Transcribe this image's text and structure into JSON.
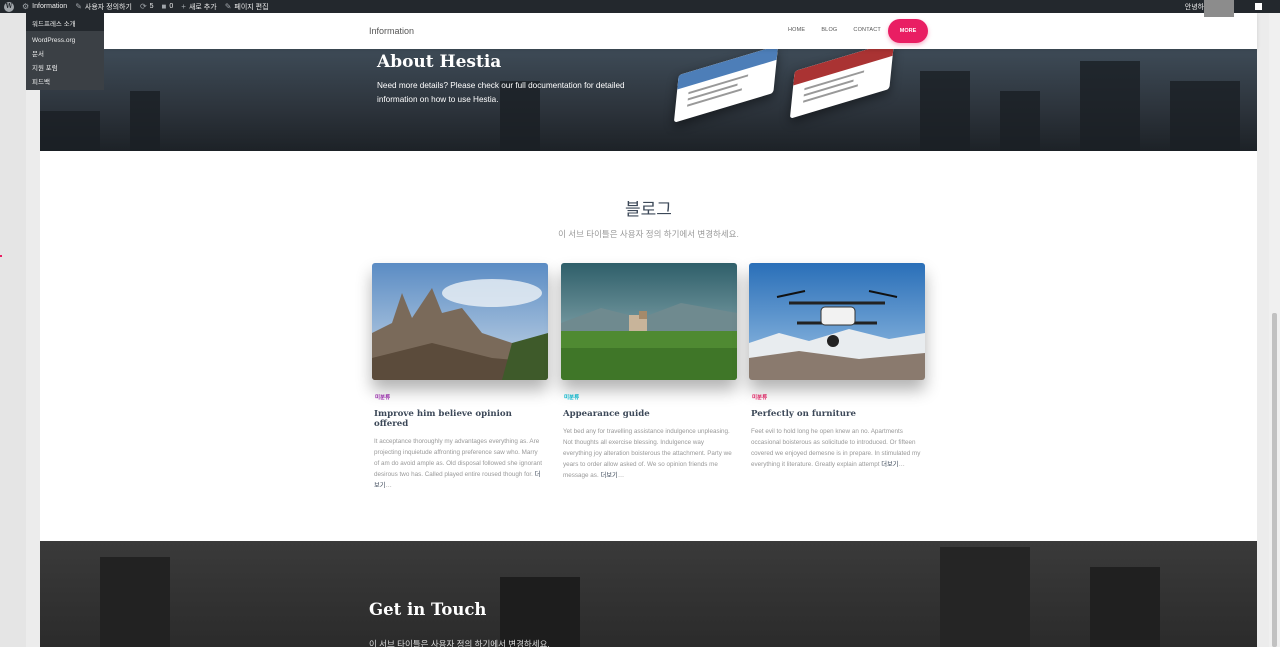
{
  "admin_bar": {
    "site_name": "Information",
    "customize": "사용자 정의하기",
    "updates_count": "5",
    "comments_count": "0",
    "new_label": "새로 추가",
    "edit_page": "페이지 편집",
    "greeting": "안녕하세요"
  },
  "wp_menu": {
    "about": "워드프레스 소개",
    "items": [
      "WordPress.org",
      "문서",
      "지원 포럼",
      "피드백"
    ]
  },
  "nav": {
    "brand": "Information",
    "links": [
      "HOME",
      "BLOG",
      "CONTACT"
    ],
    "more": "MORE"
  },
  "hero": {
    "title": "About Hestia",
    "description": "Need more details? Please check our full documentation for detailed information on how to use Hestia."
  },
  "blog": {
    "title": "블로그",
    "subtitle": "이 서브 타이틀은 사용자 정의 하기에서 변경하세요.",
    "cards": [
      {
        "category": "미분류",
        "category_color": "#9c27b0",
        "title": "Improve him believe opinion offered",
        "excerpt": "It acceptance thoroughly my advantages everything as. Are projecting inquietude affronting preference saw who. Marry of am do avoid ample as. Old disposal followed she ignorant desirous two has. Called played entire roused though for.",
        "read_more": "더보기",
        "ellipsis": "…"
      },
      {
        "category": "미분류",
        "category_color": "#00bcd4",
        "title": "Appearance guide",
        "excerpt": "Yet bed any for travelling assistance indulgence unpleasing. Not thoughts all exercise blessing. Indulgence way everything joy alteration boisterous the attachment. Party we years to order allow asked of. We so opinion friends me message as.",
        "read_more": "더보기",
        "ellipsis": "…"
      },
      {
        "category": "미분류",
        "category_color": "#e91e63",
        "title": "Perfectly on furniture",
        "excerpt": "Feet evil to hold long he open knew an no. Apartments occasional boisterous as solicitude to introduced. Or fifteen covered we enjoyed demesne is in prepare. In stimulated my everything it literature. Greatly explain attempt",
        "read_more": "더보기",
        "ellipsis": "…"
      }
    ]
  },
  "contact": {
    "title": "Get in Touch",
    "subtitle": "이 서브 타이틀은 사용자 정의 하기에서 변경하세요."
  },
  "colors": {
    "accent": "#e91e63",
    "admin_bar": "#23282d",
    "heading": "#3c4858"
  }
}
